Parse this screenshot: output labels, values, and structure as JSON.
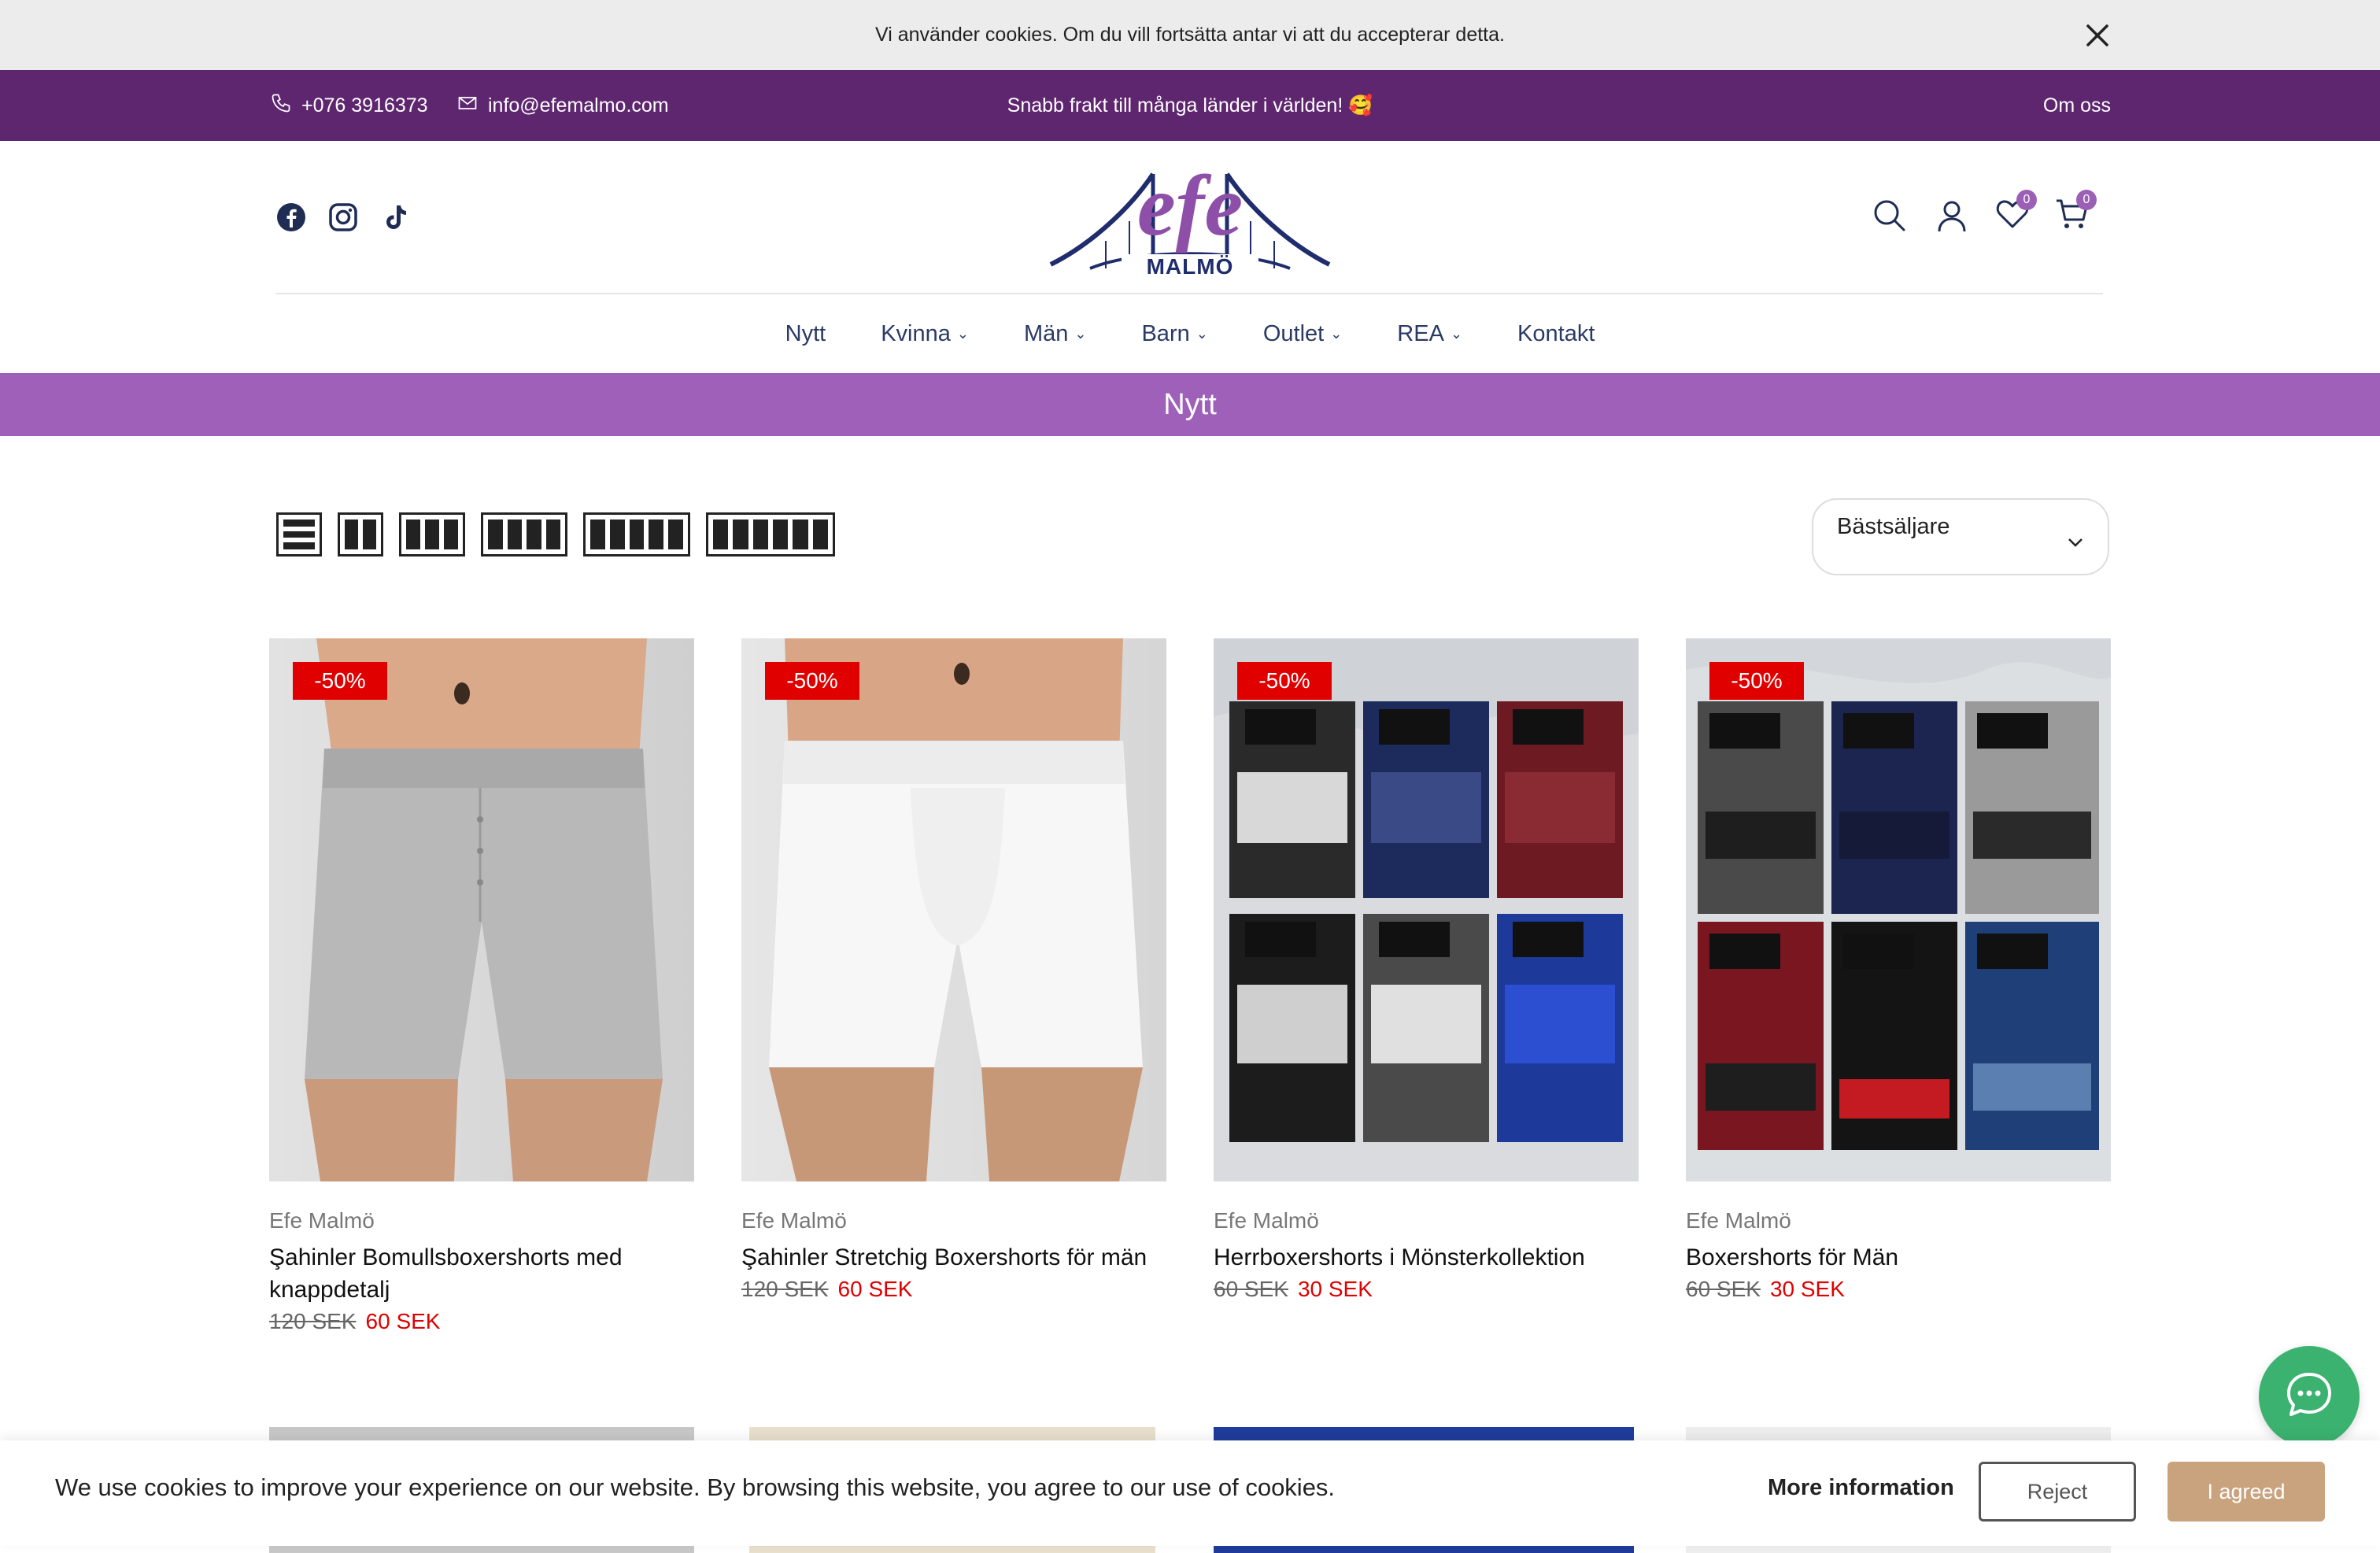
{
  "cookie_top": {
    "text": "Vi använder cookies. Om du vill fortsätta antar vi att du accepterar detta."
  },
  "topbar": {
    "phone": "+076 3916373",
    "email": "info@efemalmo.com",
    "shipping": "Snabb frakt till många länder i världen! 🥰",
    "about": "Om oss"
  },
  "header": {
    "logo_text": "efe",
    "logo_sub": "MALMÖ",
    "wishlist_count": "0",
    "cart_count": "0"
  },
  "nav": {
    "items": [
      "Nytt",
      "Kvinna",
      "Män",
      "Barn",
      "Outlet",
      "REA",
      "Kontakt"
    ]
  },
  "page": {
    "title": "Nytt"
  },
  "sort": {
    "selected": "Bästsäljare"
  },
  "products": [
    {
      "badge": "-50%",
      "brand": "Efe Malmö",
      "name": "Şahinler Bomullsboxershorts med knappdetalj",
      "old_price": "120 SEK",
      "price": "60 SEK"
    },
    {
      "badge": "-50%",
      "brand": "Efe Malmö",
      "name": "Şahinler Stretchig Boxershorts för män",
      "old_price": "120 SEK",
      "price": "60 SEK"
    },
    {
      "badge": "-50%",
      "brand": "Efe Malmö",
      "name": "Herrboxershorts i Mönsterkollektion",
      "old_price": "60 SEK",
      "price": "30 SEK"
    },
    {
      "badge": "-50%",
      "brand": "Efe Malmö",
      "name": "Boxershorts för Män",
      "old_price": "60 SEK",
      "price": "30 SEK"
    }
  ],
  "cookie_bottom": {
    "message": "We use cookies to improve your experience on our website. By browsing this website, you agree to our use of cookies.",
    "more": "More information",
    "reject": "Reject",
    "agree": "I agreed"
  },
  "colors": {
    "topbar": "#5f2670",
    "titlebar": "#9e60b8",
    "sale": "#e00000",
    "chat": "#3bb270",
    "agree": "#c9a27e"
  }
}
